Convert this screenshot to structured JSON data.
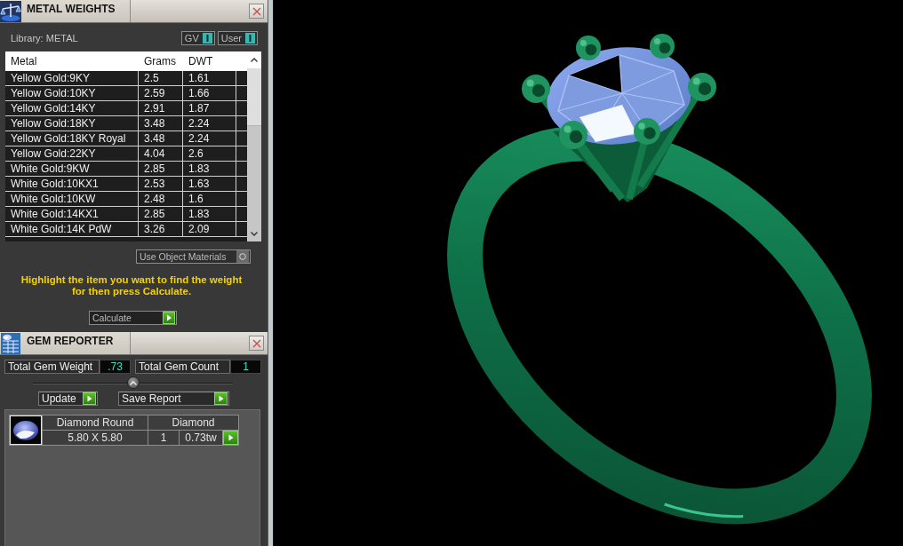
{
  "metal_weights": {
    "title": "METAL WEIGHTS",
    "library": "Library: METAL",
    "toggles": [
      {
        "label": "GV",
        "on": true
      },
      {
        "label": "User",
        "on": true
      }
    ],
    "table": {
      "columns": [
        "Metal",
        "Grams",
        "DWT"
      ],
      "rows": [
        {
          "metal": "Yellow Gold:9KY",
          "grams": "2.5",
          "dwt": "1.61",
          "selected": false
        },
        {
          "metal": "Yellow Gold:10KY",
          "grams": "2.59",
          "dwt": "1.66",
          "selected": false
        },
        {
          "metal": "Yellow Gold:14KY",
          "grams": "2.91",
          "dwt": "1.87",
          "selected": false
        },
        {
          "metal": "Yellow Gold:18KY",
          "grams": "3.48",
          "dwt": "2.24",
          "selected": false
        },
        {
          "metal": "Yellow Gold:18KY Royal",
          "grams": "3.48",
          "dwt": "2.24",
          "selected": false
        },
        {
          "metal": "Yellow Gold:22KY",
          "grams": "4.04",
          "dwt": "2.6",
          "selected": false
        },
        {
          "metal": "White Gold:9KW",
          "grams": "2.85",
          "dwt": "1.83",
          "selected": false
        },
        {
          "metal": "White Gold:10KX1",
          "grams": "2.53",
          "dwt": "1.63",
          "selected": false
        },
        {
          "metal": "White Gold:10KW",
          "grams": "2.48",
          "dwt": "1.6",
          "selected": false
        },
        {
          "metal": "White Gold:14KX1",
          "grams": "2.85",
          "dwt": "1.83",
          "selected": false
        },
        {
          "metal": "White Gold:14K PdW",
          "grams": "3.26",
          "dwt": "2.09",
          "selected": false
        }
      ]
    },
    "use_object_materials": {
      "label": "Use Object Materials",
      "on": false
    },
    "instruction": "Highlight the item you want to find the weight for then press Calculate.",
    "calculate_button": "Calculate"
  },
  "gem_reporter": {
    "title": "GEM REPORTER",
    "totals": [
      {
        "label": "Total Gem Weight",
        "value": ".73"
      },
      {
        "label": "Total Gem Count",
        "value": "1"
      }
    ],
    "buttons": [
      "Update",
      "Save Report"
    ],
    "gems": [
      {
        "shape": "Diamond Round",
        "type": "Diamond",
        "size": "5.80 X 5.80",
        "count": "1",
        "weight": "0.73tw"
      }
    ]
  }
}
